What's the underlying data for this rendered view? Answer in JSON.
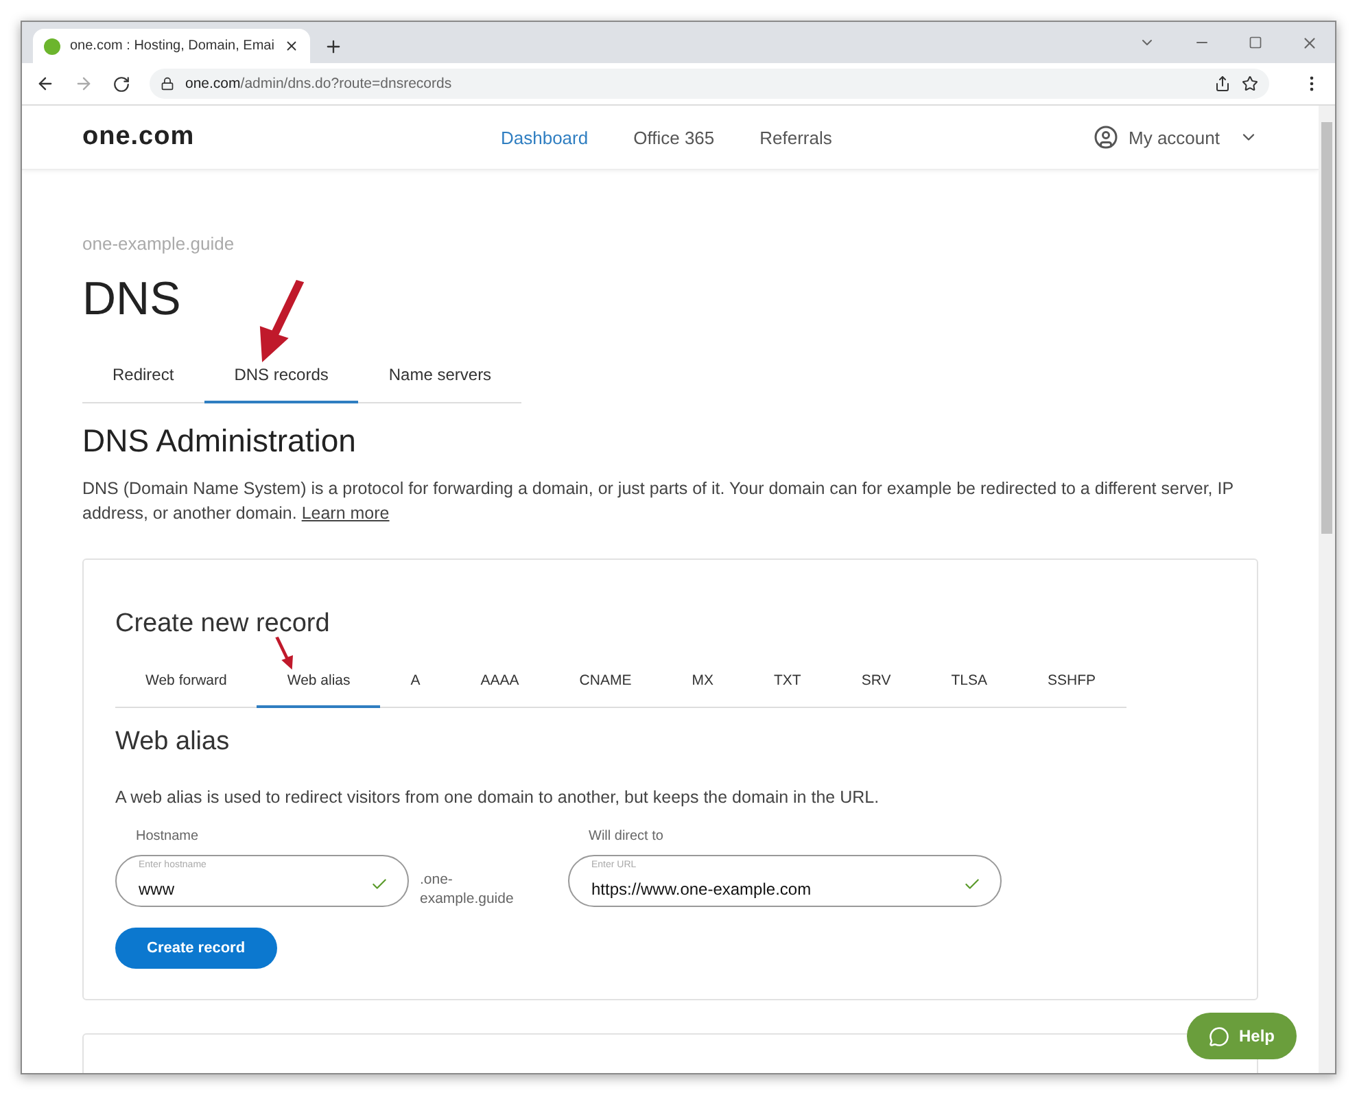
{
  "browser": {
    "tab_title": "one.com : Hosting, Domain, Emai",
    "url_host": "one.com",
    "url_path": "/admin/dns.do?route=dnsrecords"
  },
  "header": {
    "logo": "one.com",
    "nav": [
      {
        "label": "Dashboard",
        "selected": true
      },
      {
        "label": "Office 365",
        "selected": false
      },
      {
        "label": "Referrals",
        "selected": false
      }
    ],
    "account": "My account"
  },
  "domain": "one-example.guide",
  "title": "DNS",
  "tabs": [
    {
      "label": "Redirect",
      "selected": false,
      "marked": false
    },
    {
      "label": "DNS records",
      "selected": true,
      "marked": true
    },
    {
      "label": "Name servers",
      "selected": false,
      "marked": false
    }
  ],
  "section_title": "DNS Administration",
  "intro": "DNS (Domain Name System) is a protocol for forwarding a domain, or just parts of it. Your domain can for example be redirected to a different server, IP address, or another domain.",
  "learn_more": "Learn more",
  "card": {
    "title": "Create new record",
    "record_tabs": [
      {
        "label": "Web forward",
        "selected": false,
        "marked": false
      },
      {
        "label": "Web alias",
        "selected": true,
        "marked": true
      },
      {
        "label": "A",
        "selected": false,
        "marked": false
      },
      {
        "label": "AAAA",
        "selected": false,
        "marked": false
      },
      {
        "label": "CNAME",
        "selected": false,
        "marked": false
      },
      {
        "label": "MX",
        "selected": false,
        "marked": false
      },
      {
        "label": "TXT",
        "selected": false,
        "marked": false
      },
      {
        "label": "SRV",
        "selected": false,
        "marked": false
      },
      {
        "label": "TLSA",
        "selected": false,
        "marked": false
      },
      {
        "label": "SSHFP",
        "selected": false,
        "marked": false
      }
    ],
    "form_title": "Web alias",
    "description": "A web alias is used to redirect visitors from one domain to another, but keeps the domain in the URL.",
    "hostname": {
      "label": "Hostname",
      "placeholder": "Enter hostname",
      "value": "www",
      "valid": true
    },
    "suffix": ".one-example.guide",
    "target": {
      "label": "Will direct to",
      "placeholder": "Enter URL",
      "value": "https://www.one-example.com",
      "valid": true
    },
    "button": "Create record"
  },
  "help": "Help"
}
